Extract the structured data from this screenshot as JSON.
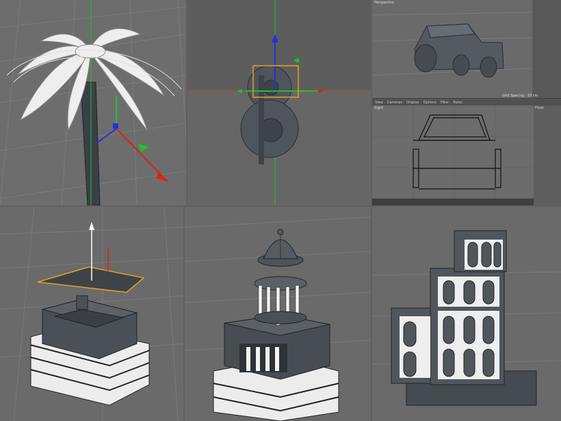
{
  "panels": {
    "perspective_label": "Perspective",
    "right_label": "Right",
    "front_label": "Front",
    "grid_spacing": "Grid Spacing : 10 cm",
    "menu": [
      "View",
      "Cameras",
      "Display",
      "Options",
      "Filter",
      "Panel"
    ]
  },
  "colors": {
    "viewport_bg": "#6a6a6a",
    "grid_line": "#7a7a7a",
    "model_dark": "#3d4349",
    "model_mid": "#555b61",
    "model_light": "#e8e8e8",
    "axis_red": "#e0201a",
    "axis_green": "#22c02a",
    "axis_blue": "#2030e0",
    "selection_orange": "#e8a020"
  }
}
